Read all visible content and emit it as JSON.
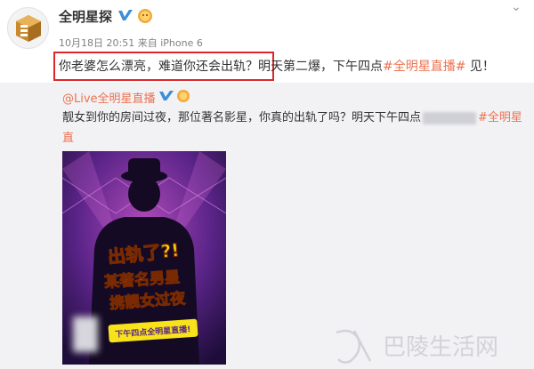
{
  "post": {
    "username": "全明星探",
    "date": "10月18日 20:51",
    "source_prefix": "来自",
    "device": "iPhone 6",
    "text_highlighted": "你老婆怎么漂亮，难道你还会出轨？",
    "text_rest": "明天第二爆，下午四点",
    "hashtag": "#全明星直播#",
    "text_end": "见！"
  },
  "repost": {
    "username": "@Live全明星直播",
    "text_a": "靓女到你的房间过夜，那位著名影星，你真的出轨了吗？明天下午四点",
    "hashtag_a": "#全明星直",
    "hashtag_b": "播#",
    "text_b": "见！"
  },
  "poster": {
    "line1": "出轨了?!",
    "line2": "某著名男星",
    "line3": "携靓女过夜",
    "line4": "下午四点全明星直播!"
  },
  "watermark": {
    "text": "巴陵生活网"
  },
  "colors": {
    "hashtag": "#eb7350",
    "highlight_box": "#e0242a",
    "repost_bg": "#f2f2f5"
  },
  "icons": [
    "close-icon",
    "verified-v-icon",
    "fan-badge-icon",
    "verified-v-icon",
    "fan-badge-icon"
  ]
}
